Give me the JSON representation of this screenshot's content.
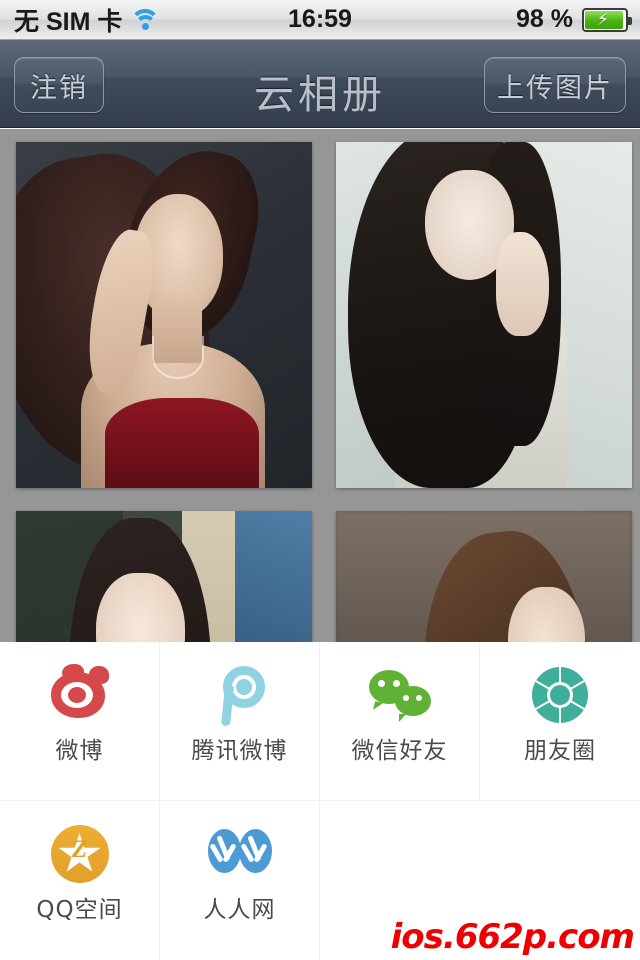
{
  "status_bar": {
    "carrier": "无 SIM 卡",
    "wifi_icon": "wifi-icon",
    "time": "16:59",
    "battery_percent": "98 %",
    "battery_icon": "battery-charging-icon"
  },
  "nav_bar": {
    "title": "云相册",
    "left_button": "注销",
    "right_button": "上传图片"
  },
  "photo_grid": {
    "background_color": "#969696",
    "photos": [
      {
        "alt": "portrait-dark-studio"
      },
      {
        "alt": "portrait-pale-bright"
      },
      {
        "alt": "portrait-in-car"
      },
      {
        "alt": "portrait-outdoor"
      }
    ]
  },
  "share_sheet": {
    "background_color": "#ffffff",
    "items": [
      {
        "label": "微博",
        "icon": "weibo-icon",
        "color": "#d6494a"
      },
      {
        "label": "腾讯微博",
        "icon": "tencent-weibo-icon",
        "color": "#8fd3e2"
      },
      {
        "label": "微信好友",
        "icon": "wechat-icon",
        "color": "#5fb236"
      },
      {
        "label": "朋友圈",
        "icon": "moments-icon",
        "color": "#3fae9a"
      },
      {
        "label": "QQ空间",
        "icon": "qzone-icon",
        "color": "#eead33"
      },
      {
        "label": "人人网",
        "icon": "renren-icon",
        "color": "#4d9bd4"
      }
    ]
  },
  "watermark": {
    "text": "ios.662p.com",
    "color": "#ee0000"
  }
}
